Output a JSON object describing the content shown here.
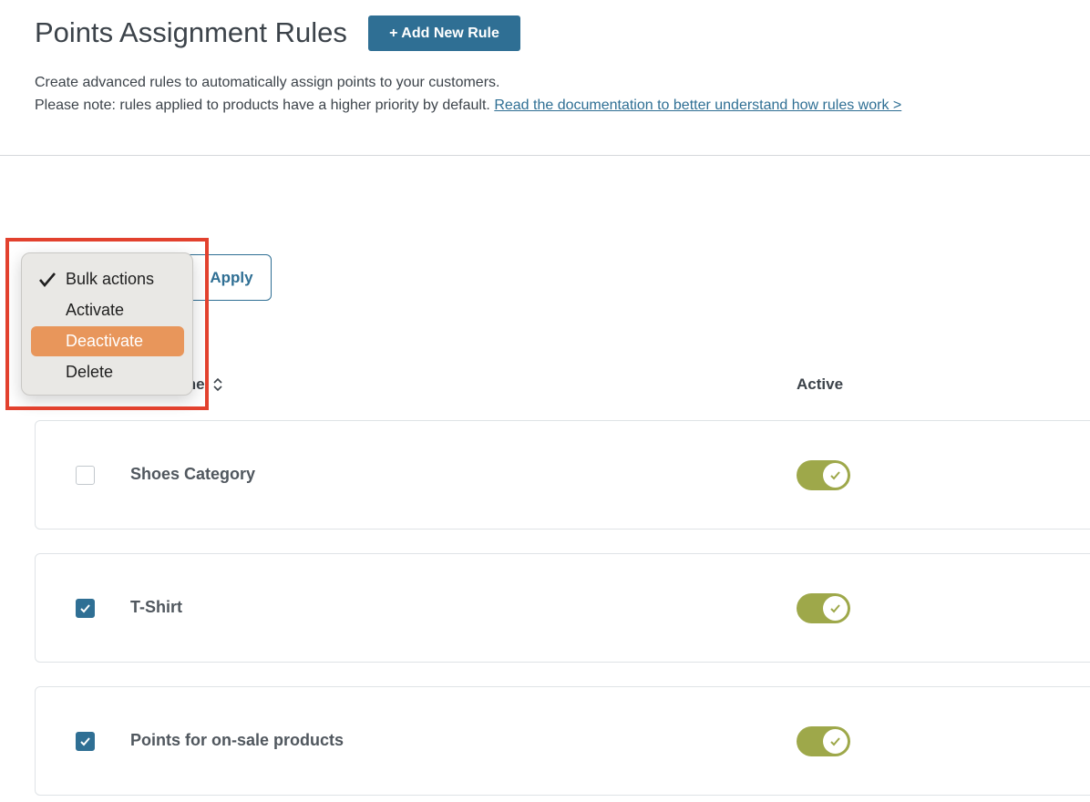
{
  "header": {
    "title": "Points Assignment Rules",
    "add_button_label": "+ Add New Rule",
    "description_line1": "Create advanced rules to automatically assign points to your customers.",
    "description_line2": "Please note: rules applied to products have a higher priority by default.",
    "doc_link": "Read the documentation to better understand how rules work >"
  },
  "bulk": {
    "apply_label": "Apply",
    "options": [
      {
        "label": "Bulk actions",
        "checked": true
      },
      {
        "label": "Activate",
        "checked": false
      },
      {
        "label": "Deactivate",
        "checked": false,
        "highlighted": true
      },
      {
        "label": "Delete",
        "checked": false
      }
    ]
  },
  "table": {
    "name_header_visible": "me",
    "active_header": "Active",
    "rows": [
      {
        "name": "Shoes Category",
        "checked": false,
        "active": true
      },
      {
        "name": "T-Shirt",
        "checked": true,
        "active": true
      },
      {
        "name": "Points for on-sale products",
        "checked": true,
        "active": true
      }
    ]
  },
  "colors": {
    "primary": "#2f6f94",
    "toggle_on": "#9ea84a",
    "menu_highlight": "#e8965b",
    "annotation_border": "#e2412e"
  }
}
